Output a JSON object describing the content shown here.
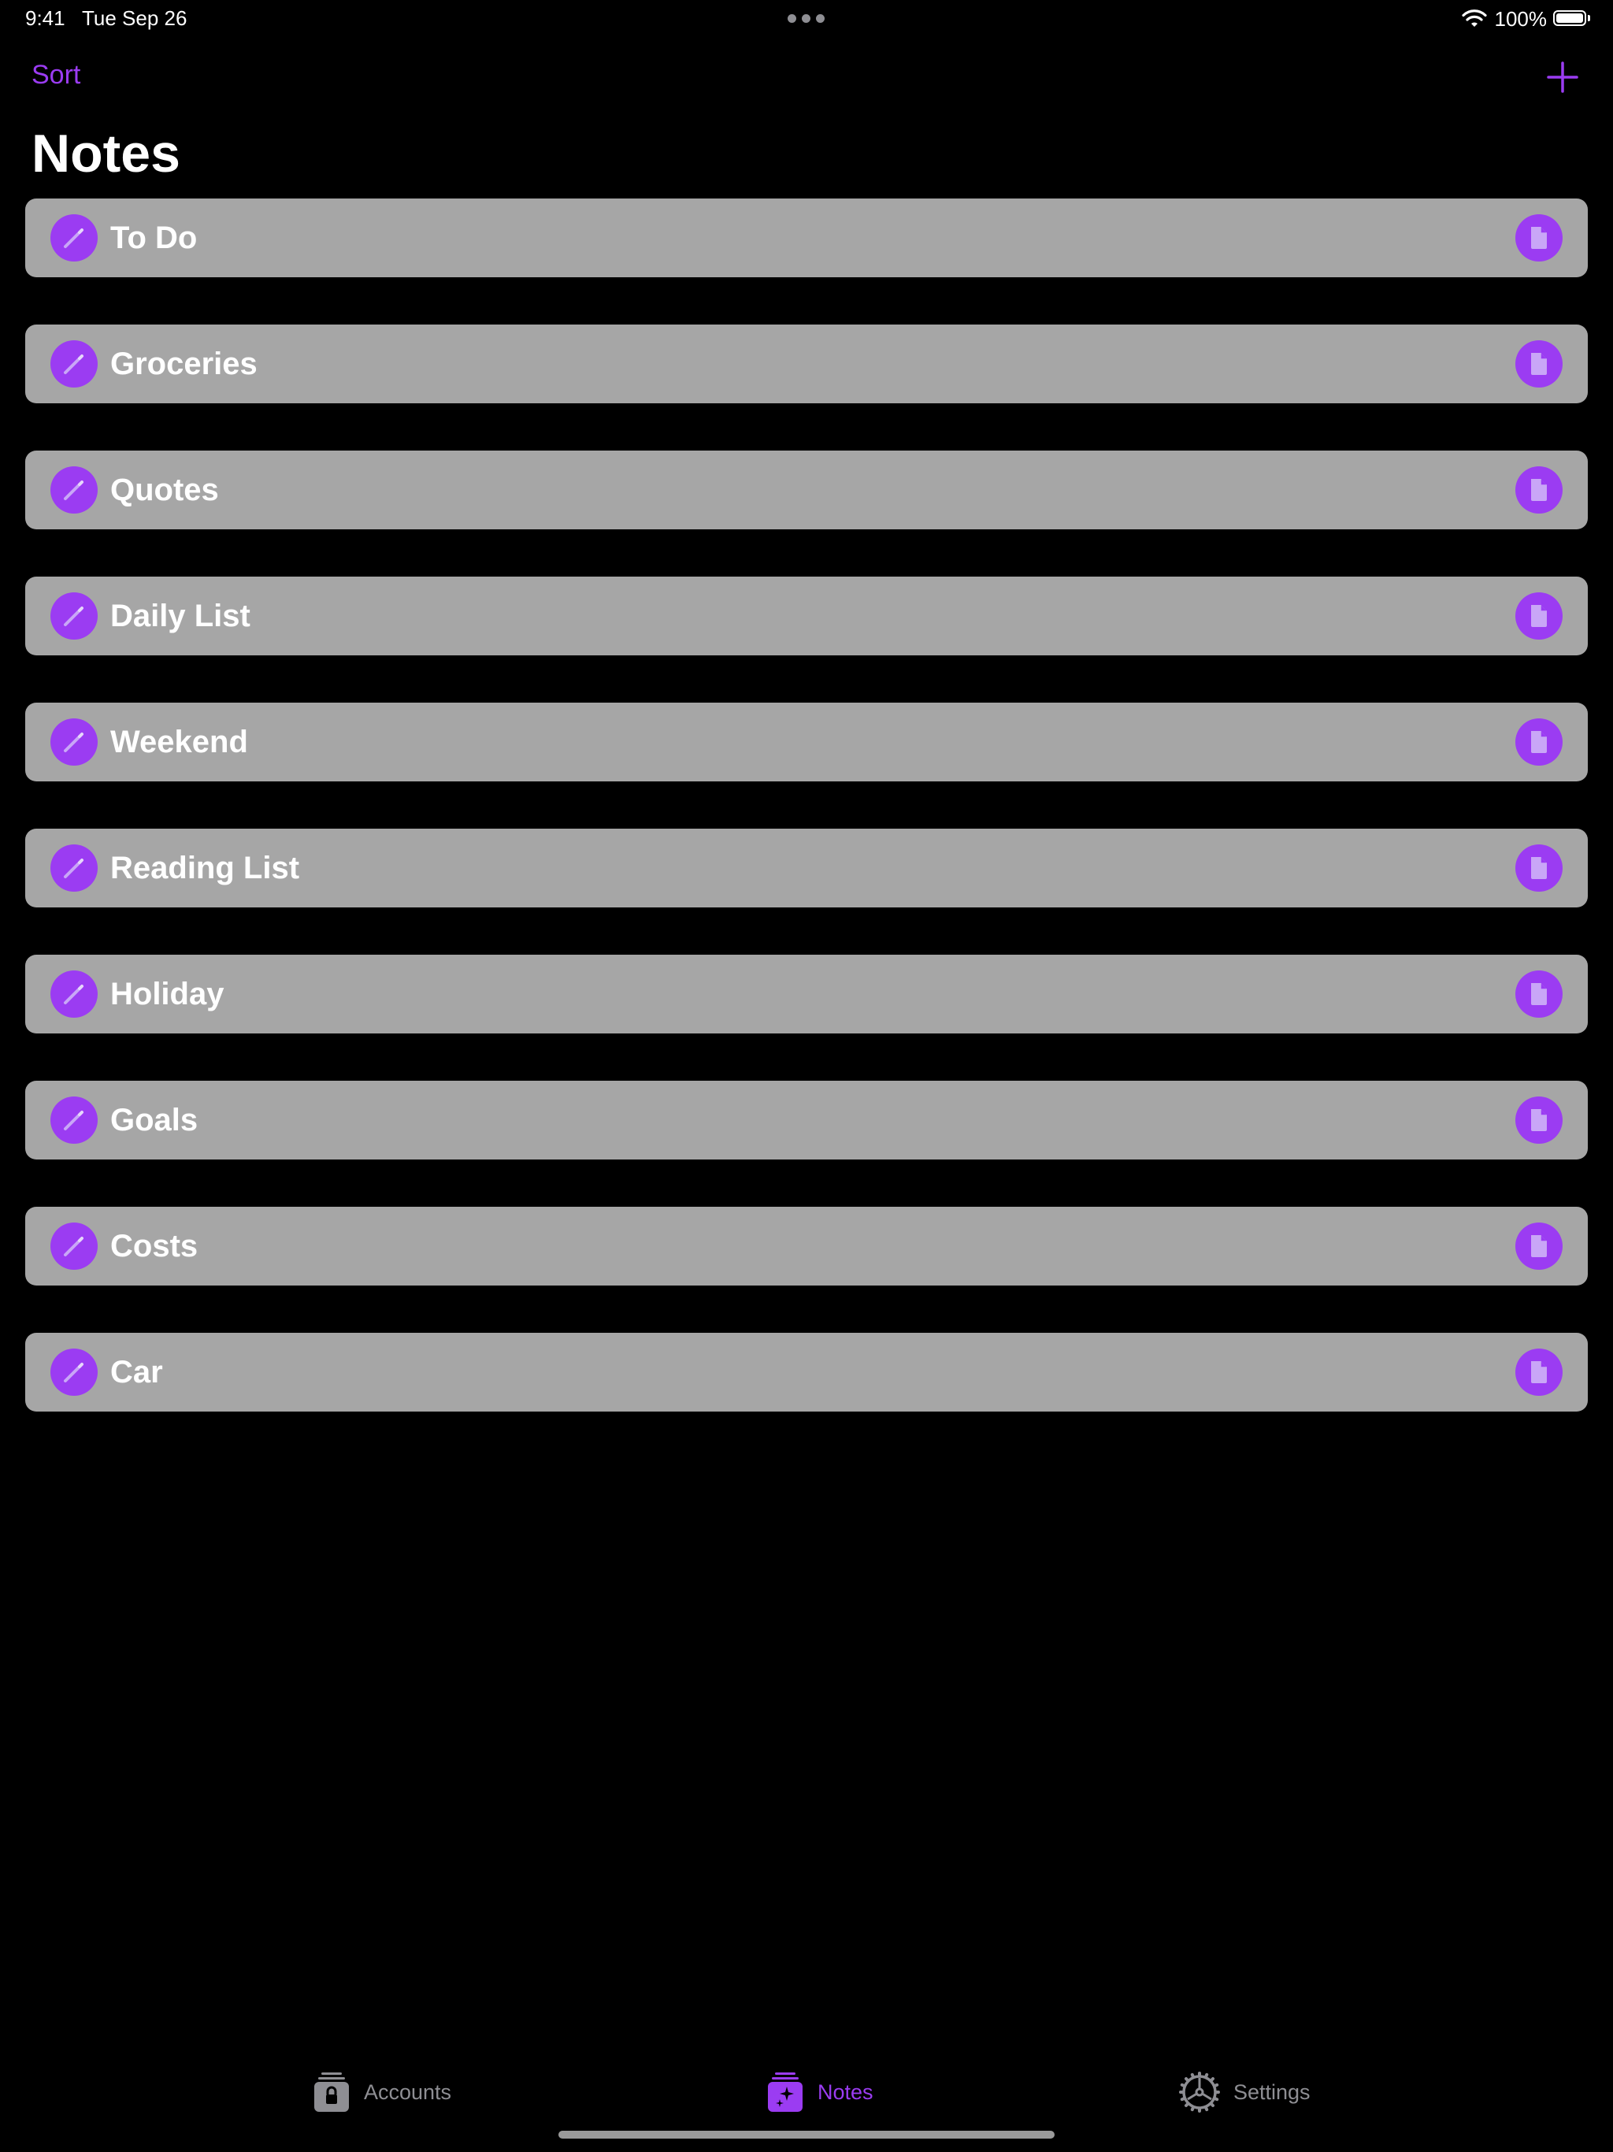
{
  "status_bar": {
    "time": "9:41",
    "date": "Tue Sep 26",
    "battery_percent": "100%",
    "battery_level": 1.0,
    "icons": [
      "wifi-icon",
      "battery-icon"
    ]
  },
  "nav": {
    "sort_label": "Sort",
    "add_icon": "plus-icon",
    "title": "Notes"
  },
  "notes": [
    {
      "title": "To Do"
    },
    {
      "title": "Groceries"
    },
    {
      "title": "Quotes"
    },
    {
      "title": "Daily List"
    },
    {
      "title": "Weekend"
    },
    {
      "title": "Reading List"
    },
    {
      "title": "Holiday"
    },
    {
      "title": "Goals"
    },
    {
      "title": "Costs"
    },
    {
      "title": "Car"
    }
  ],
  "tabs": [
    {
      "label": "Accounts",
      "icon": "lock-stack-icon",
      "selected": false
    },
    {
      "label": "Notes",
      "icon": "sparkle-stack-icon",
      "selected": true
    },
    {
      "label": "Settings",
      "icon": "gear-icon",
      "selected": false
    }
  ],
  "colors": {
    "accent": "#9b3cf2",
    "row_background": "#a6a6a6",
    "background": "#000000",
    "inactive_tab": "#8e8e93"
  }
}
